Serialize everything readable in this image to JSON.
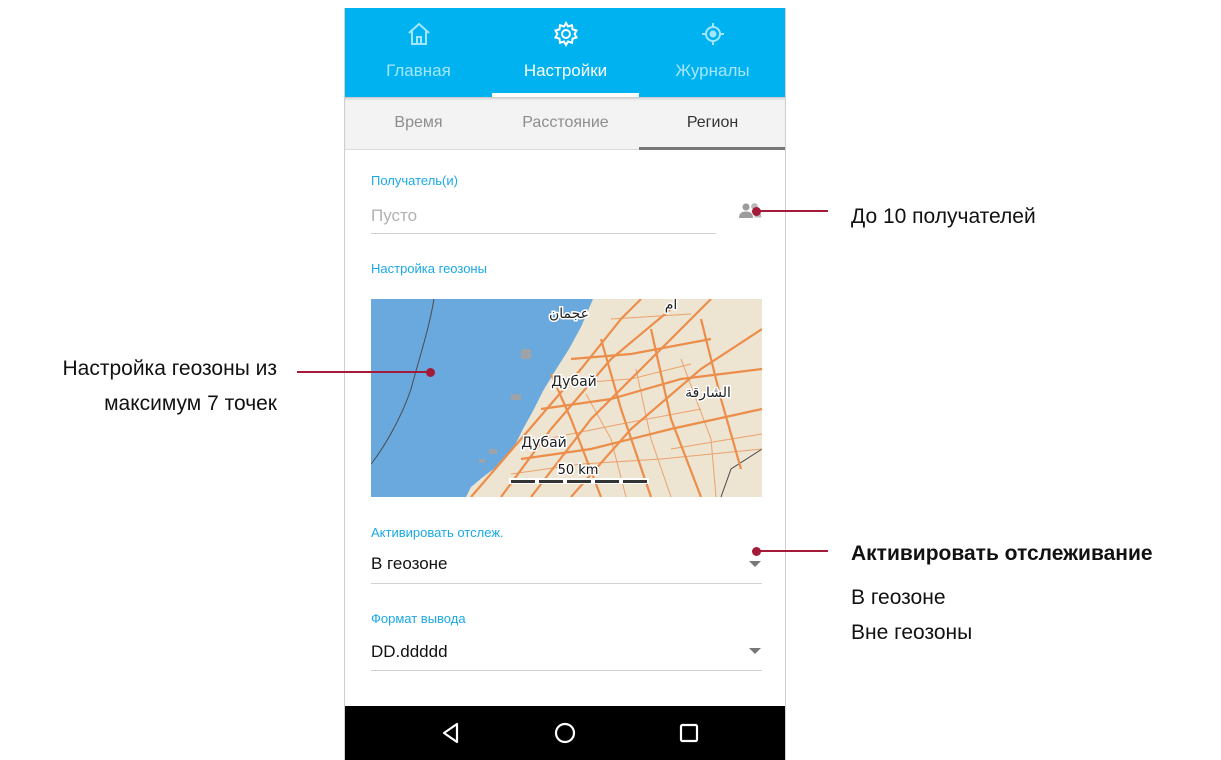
{
  "top_tabs": [
    {
      "label": "Главная",
      "icon": "home-icon"
    },
    {
      "label": "Настройки",
      "icon": "gear-icon"
    },
    {
      "label": "Журналы",
      "icon": "target-icon"
    }
  ],
  "sub_tabs": [
    "Время",
    "Расстояние",
    "Регион"
  ],
  "active_top_tab": "Настройки",
  "active_sub_tab": "Регион",
  "recipients": {
    "label": "Получатель(и)",
    "placeholder": "Пусто",
    "icon": "people-icon"
  },
  "geofence": {
    "label": "Настройка геозоны",
    "map": {
      "place_labels": [
        "عجمان",
        "Дубай",
        "الشارقة",
        "Дубай",
        "أم"
      ],
      "scale_label": "50 km"
    }
  },
  "tracking": {
    "label": "Активировать отслеж.",
    "value": "В геозоне"
  },
  "output_format": {
    "label": "Формат вывода",
    "value": "DD.ddddd"
  },
  "nav_icons": [
    "back-icon",
    "home-circle-icon",
    "recent-apps-icon"
  ],
  "callouts": {
    "recipients": "До 10 получателей",
    "geofence_line1": "Настройка геозоны из",
    "geofence_line2": "максимум 7 точек",
    "tracking_title": "Активировать отслеживание",
    "tracking_opt1": "В геозоне",
    "tracking_opt2": "Вне геозоны"
  },
  "colors": {
    "header": "#00b3f0",
    "accent_label": "#1aa9e6",
    "callout_line": "#a31b38",
    "map_water": "#6aa9de",
    "map_land": "#ede4d2",
    "map_roads": "#ec8d4a"
  }
}
